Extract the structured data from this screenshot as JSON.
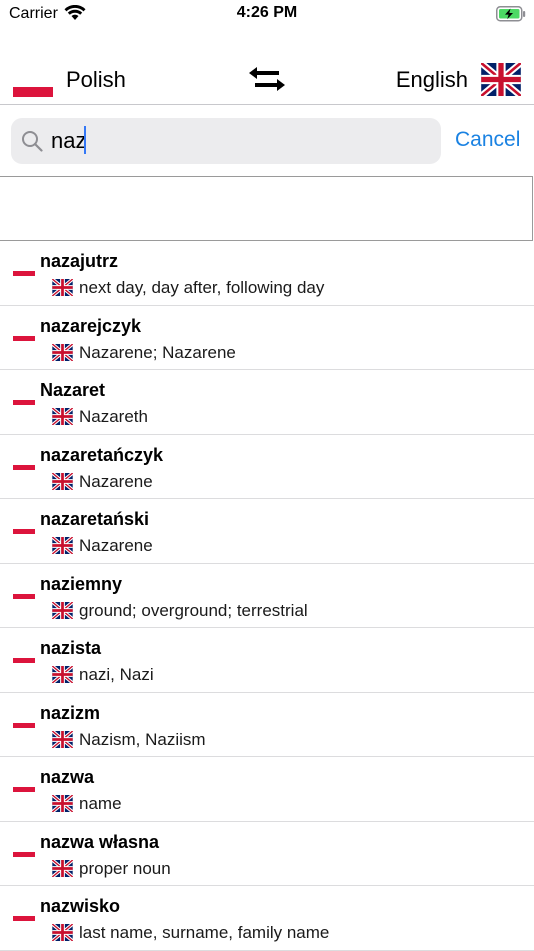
{
  "status": {
    "carrier": "Carrier",
    "time": "4:26 PM"
  },
  "languages": {
    "from": "Polish",
    "to": "English"
  },
  "search": {
    "value": "naz",
    "cancel_label": "Cancel"
  },
  "results": [
    {
      "word": "nazajutrz",
      "translation": "next day, day after, following day"
    },
    {
      "word": "nazarejczyk",
      "translation": "Nazarene; Nazarene"
    },
    {
      "word": "Nazaret",
      "translation": "Nazareth"
    },
    {
      "word": "nazaretańczyk",
      "translation": "Nazarene"
    },
    {
      "word": "nazaretański",
      "translation": "Nazarene"
    },
    {
      "word": "naziemny",
      "translation": "ground; overground; terrestrial"
    },
    {
      "word": "nazista",
      "translation": "nazi, Nazi"
    },
    {
      "word": "nazizm",
      "translation": "Nazism, Naziism"
    },
    {
      "word": "nazwa",
      "translation": "name"
    },
    {
      "word": "nazwa własna",
      "translation": "proper noun"
    },
    {
      "word": "nazwisko",
      "translation": "last name, surname, family name"
    }
  ],
  "colors": {
    "accent": "#1a82e2",
    "polish_red": "#dc143c",
    "uk_blue": "#012169",
    "uk_red": "#c8102e",
    "battery_green": "#4cd964"
  },
  "icons": {
    "wifi": "wifi-icon",
    "battery": "battery-charging-icon",
    "swap": "swap-arrows-icon",
    "search": "search-icon"
  }
}
